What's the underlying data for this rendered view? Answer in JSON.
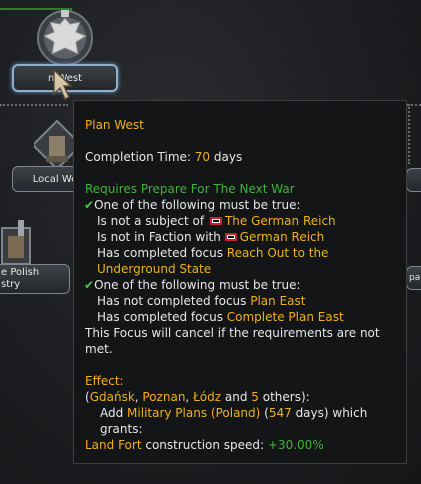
{
  "tree": {
    "node_plan_west": {
      "label": "n West"
    },
    "node_local_west": {
      "label": "Local We"
    },
    "node_polish_industry": {
      "line1": "e Polish",
      "line2": "stry"
    },
    "node_right_partial": {
      "label": "par"
    }
  },
  "tooltip": {
    "title": "Plan West",
    "completion": {
      "label": "Completion Time: ",
      "value": "70",
      "unit": " days"
    },
    "requires": "Requires Prepare For The Next War",
    "group1": {
      "header": "One of the following must be true:",
      "line1_prefix": "Is not a subject of ",
      "line1_country": "The German Reich",
      "line2_prefix": "Is not in Faction with ",
      "line2_country": "German Reich",
      "line3_prefix": "Has completed focus ",
      "line3_focus_a": "Reach Out to the",
      "line3_focus_b": "Underground State"
    },
    "group2": {
      "header": "One of the following must be true:",
      "line1_prefix": "Has not completed focus ",
      "line1_focus": "Plan East",
      "line2_prefix": "Has completed focus ",
      "line2_focus": "Complete Plan East"
    },
    "cancel_a": "This Focus will cancel if the requirements are not",
    "cancel_b": "met.",
    "effect_label": "Effect:",
    "effect_states": {
      "open": "(",
      "s1": "Gdańsk",
      "sep1": ", ",
      "s2": "Poznan",
      "sep2": ", ",
      "s3": "Łódz",
      "and": " and ",
      "count": "5",
      "others": " others",
      "close": "):"
    },
    "effect_add": {
      "prefix": "Add ",
      "plans": "Military Plans (Poland)",
      "open": " (",
      "days": "547",
      "suffix": " days) which"
    },
    "grants": "grants:",
    "bonus": {
      "label": "Land Fort",
      "mid": " construction speed: ",
      "value": "+30.00%"
    }
  },
  "colors": {
    "yellow": "#f2b019",
    "green": "#41b33a",
    "text": "#e8e8e8",
    "bg": "#141516"
  }
}
